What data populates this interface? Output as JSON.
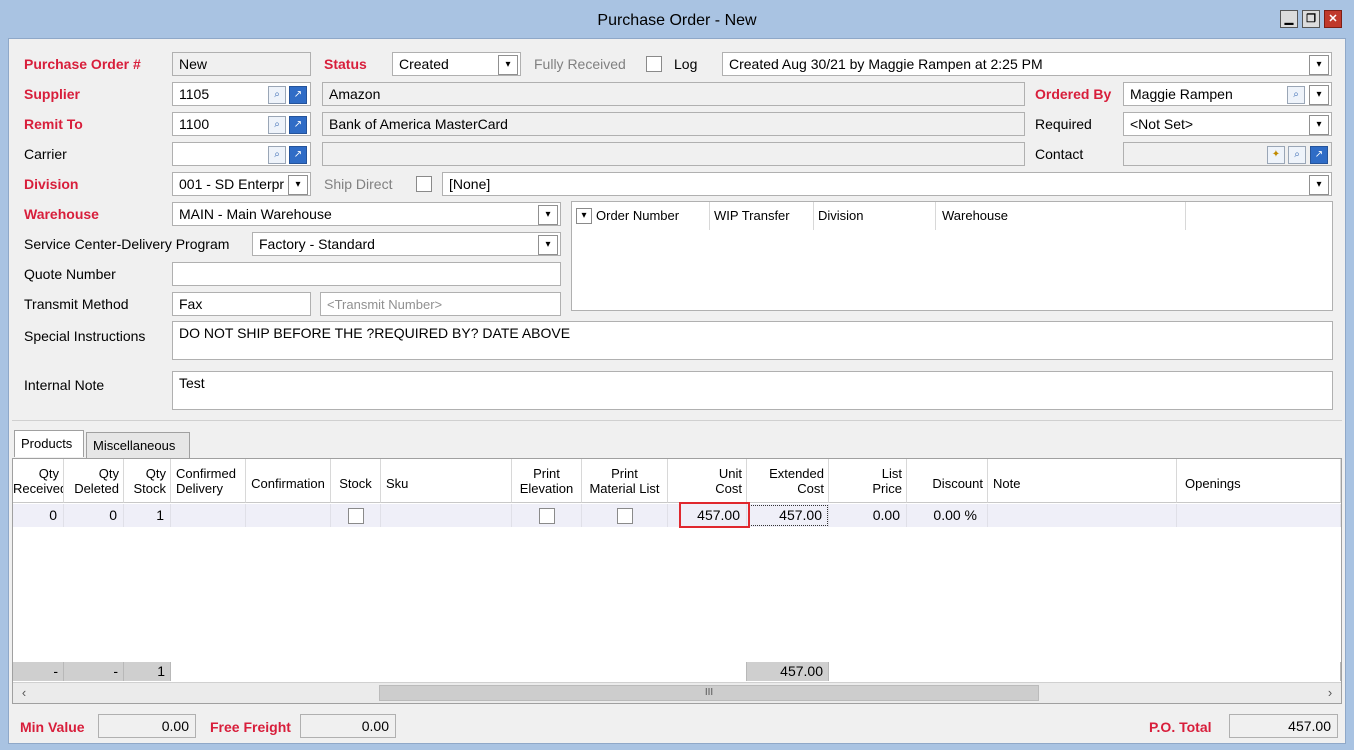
{
  "window": {
    "title": "Purchase Order - New",
    "minimize": "▁",
    "maximize": "❐",
    "close": "✕"
  },
  "header": {
    "po_label": "Purchase Order #",
    "po_value": "New",
    "status_label": "Status",
    "status_value": "Created",
    "fully_received_label": "Fully Received",
    "log_label": "Log",
    "log_value": "Created Aug 30/21 by Maggie Rampen at 2:25 PM",
    "supplier_label": "Supplier",
    "supplier_code": "1105",
    "supplier_name": "Amazon",
    "ordered_by_label": "Ordered By",
    "ordered_by_value": "Maggie Rampen",
    "remit_label": "Remit To",
    "remit_code": "1100",
    "remit_name": "Bank of America MasterCard",
    "required_label": "Required",
    "required_value": "<Not Set>",
    "carrier_label": "Carrier",
    "carrier_code": "",
    "carrier_name": "",
    "contact_label": "Contact",
    "contact_value": "",
    "division_label": "Division",
    "division_value": "001 - SD Enterpr",
    "ship_direct_label": "Ship Direct",
    "ship_direct_value": "[None]",
    "warehouse_label": "Warehouse",
    "warehouse_value": "MAIN - Main Warehouse",
    "scdp_label": "Service Center-Delivery Program",
    "scdp_value": "Factory - Standard",
    "quote_label": "Quote Number",
    "quote_value": "",
    "transmit_label": "Transmit Method",
    "transmit_value": "Fax",
    "transmit_placeholder": "<Transmit Number>",
    "special_label": "Special Instructions",
    "special_value": "DO NOT SHIP BEFORE THE ?REQUIRED BY? DATE ABOVE",
    "internal_label": "Internal Note",
    "internal_value": "Test"
  },
  "orders_list": {
    "columns": [
      "Order Number",
      "WIP Transfer",
      "Division",
      "Warehouse"
    ]
  },
  "tabs": [
    "Products",
    "Miscellaneous"
  ],
  "grid": {
    "headers": {
      "qty_received": "Qty\nReceived",
      "qty_deleted": "Qty\nDeleted",
      "qty_stock": "Qty\nStock",
      "confirmed_delivery": "Confirmed\nDelivery",
      "confirmation": "Confirmation",
      "stock": "Stock",
      "sku": "Sku",
      "print_elevation": "Print\nElevation",
      "print_material": "Print\nMaterial List",
      "unit_cost": "Unit\nCost",
      "extended_cost": "Extended\nCost",
      "list_price": "List\nPrice",
      "discount": "Discount",
      "note": "Note",
      "openings": "Openings"
    },
    "row": {
      "qty_received": "0",
      "qty_deleted": "0",
      "qty_stock": "1",
      "unit_cost": "457.00",
      "extended_cost": "457.00",
      "list_price": "0.00",
      "discount": "0.00 %"
    },
    "footer": {
      "qty_received": "-",
      "qty_deleted": "-",
      "qty_stock": "1",
      "extended_cost": "457.00"
    },
    "scroll_grip": "III"
  },
  "bottom": {
    "min_value_label": "Min Value",
    "min_value": "0.00",
    "free_freight_label": "Free Freight",
    "free_freight": "0.00",
    "po_total_label": "P.O. Total",
    "po_total": "457.00"
  },
  "colors": {
    "required_label": "#d81e3b",
    "title_bar": "#a9c3e2",
    "highlight_box": "#e0282e"
  }
}
